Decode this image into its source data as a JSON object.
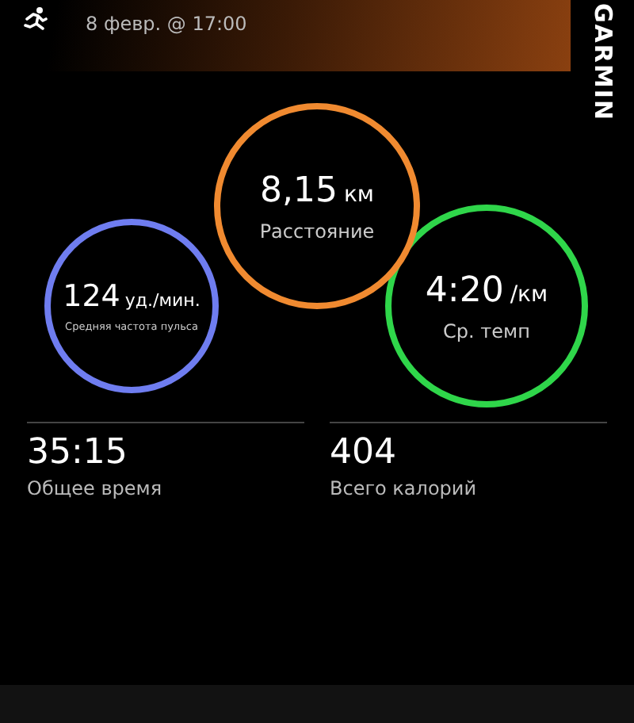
{
  "header": {
    "date": "8 февр. @ 17:00",
    "brand": "GARMIN"
  },
  "rings": [
    {
      "value": "124",
      "unit": "уд./мин.",
      "label": "Средняя частота пульса",
      "color": "#6f7df0",
      "kind": "side"
    },
    {
      "value": "8,15",
      "unit": "км",
      "label": "Расстояние",
      "color": "#f08a30",
      "kind": "center"
    },
    {
      "value": "4:20",
      "unit": "/км",
      "label": "Ср. темп",
      "color": "#2fd64a",
      "kind": "side"
    }
  ],
  "stats": [
    {
      "value": "35:15",
      "label": "Общее время"
    },
    {
      "value": "404",
      "label": "Всего калорий"
    }
  ]
}
